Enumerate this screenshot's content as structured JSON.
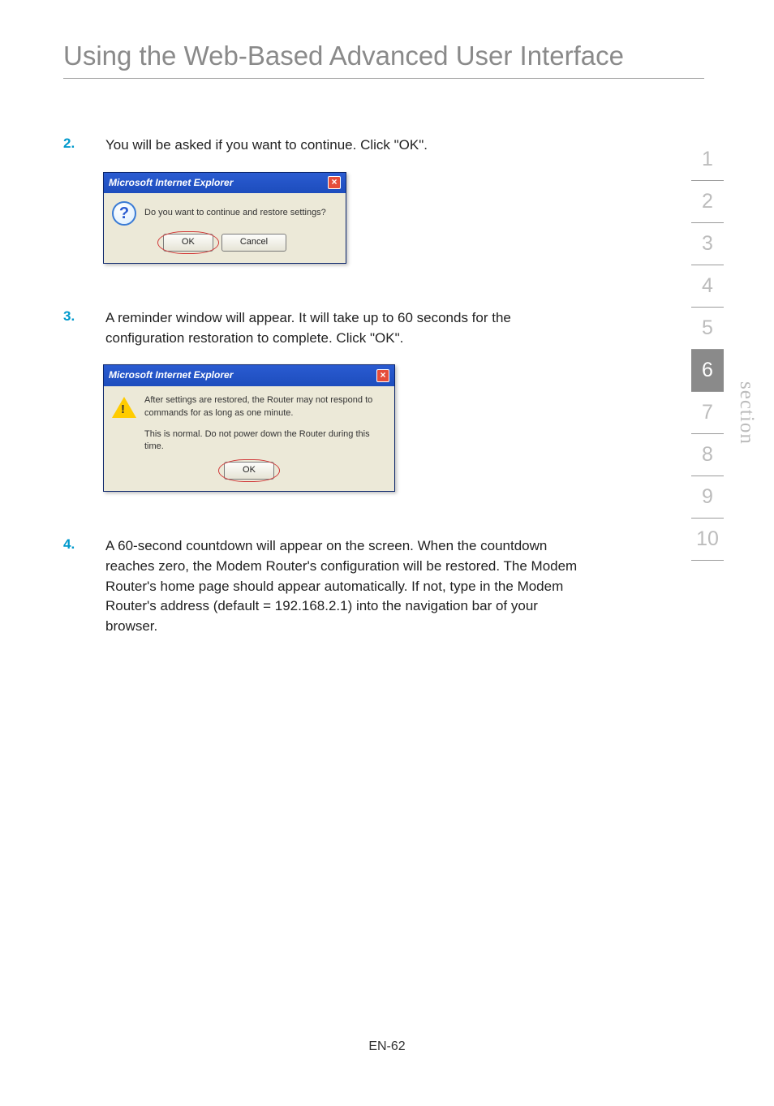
{
  "title": "Using the Web-Based Advanced User Interface",
  "steps": {
    "s2": {
      "num": "2.",
      "text": "You will be asked if you want to continue. Click \"OK\"."
    },
    "s3": {
      "num": "3.",
      "text": "A reminder window will appear. It will take up to 60 seconds for the configuration restoration to complete. Click \"OK\"."
    },
    "s4": {
      "num": "4.",
      "text": "A 60-second countdown will appear on the screen. When the countdown reaches zero, the Modem Router's configuration will be restored. The Modem Router's home page should appear automatically. If not, type in the Modem Router's address (default = 192.168.2.1) into the navigation bar of your browser."
    }
  },
  "dialog1": {
    "title": "Microsoft Internet Explorer",
    "message": "Do you want to continue and restore settings?",
    "ok": "OK",
    "cancel": "Cancel"
  },
  "dialog2": {
    "title": "Microsoft Internet Explorer",
    "message1": "After settings are restored, the Router may not respond to commands for as long as one minute.",
    "message2": "This is normal. Do not power down the Router during this time.",
    "ok": "OK"
  },
  "nav": {
    "items": [
      "1",
      "2",
      "3",
      "4",
      "5",
      "6",
      "7",
      "8",
      "9",
      "10"
    ],
    "active_index": 5,
    "label": "section"
  },
  "page_number": "EN-62"
}
